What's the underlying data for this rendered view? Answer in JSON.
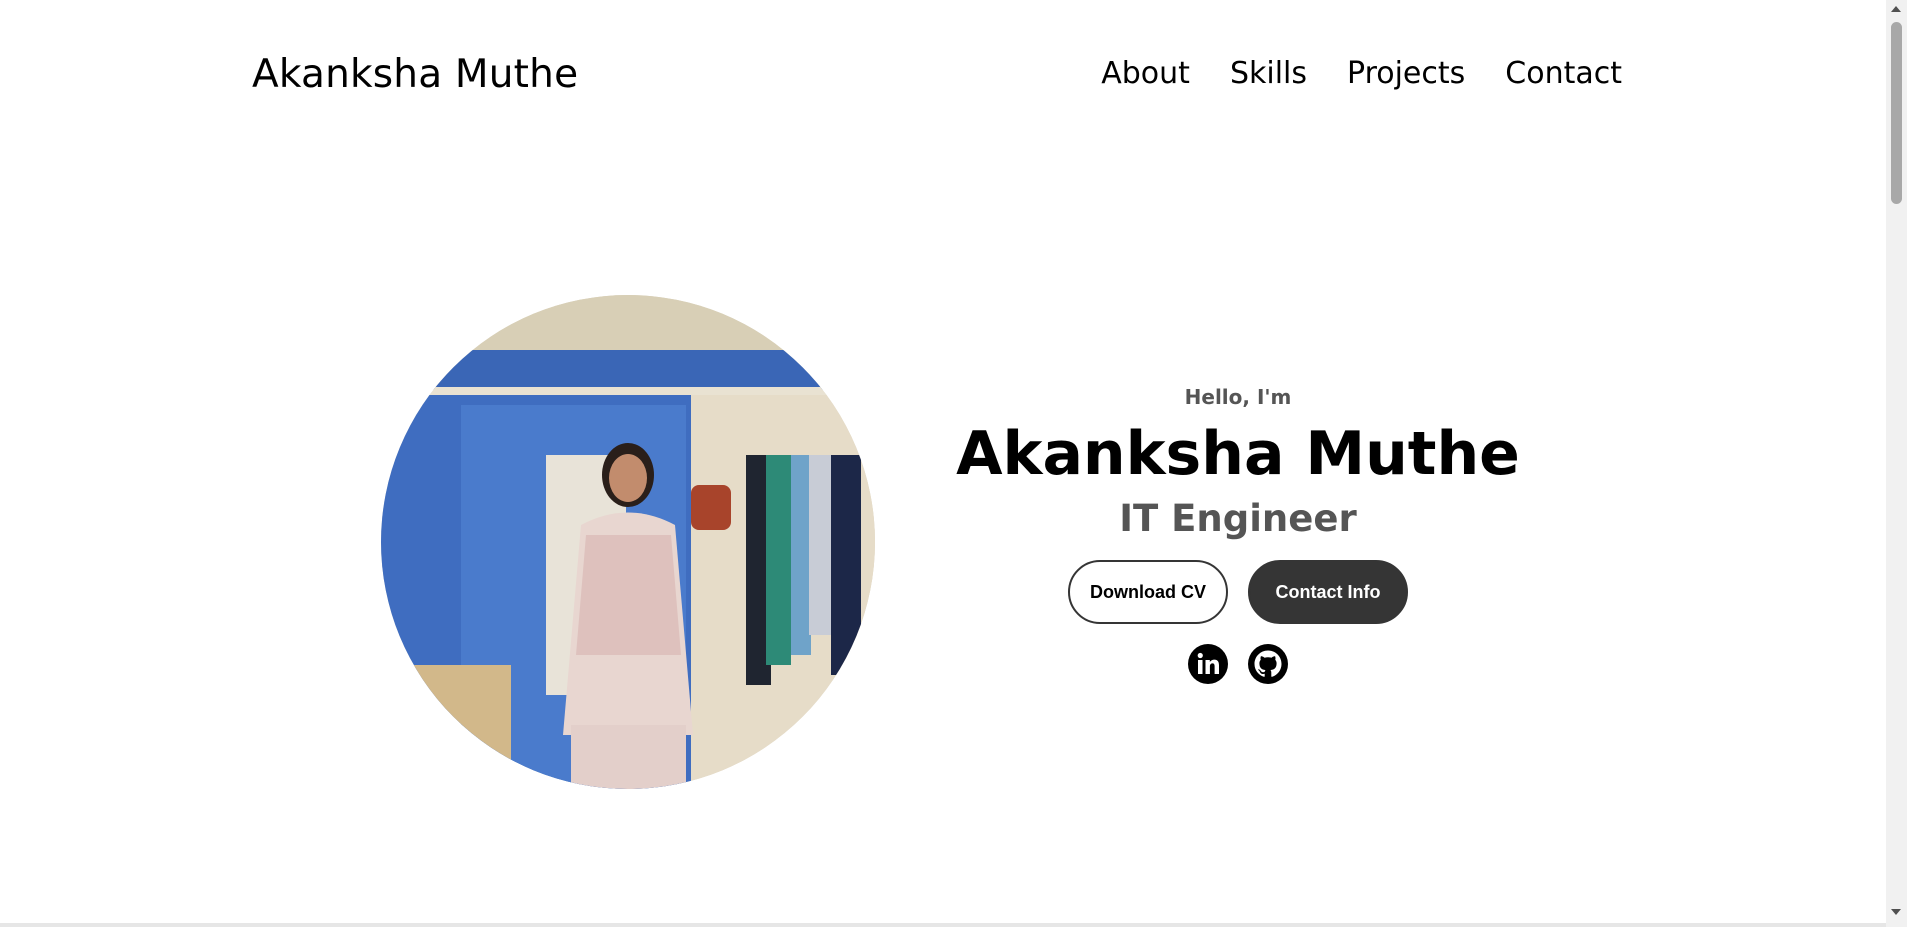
{
  "nav": {
    "logo": "Akanksha Muthe",
    "links": [
      "About",
      "Skills",
      "Projects",
      "Contact"
    ]
  },
  "hero": {
    "greeting": "Hello, I'm",
    "name": "Akanksha Muthe",
    "role": "IT Engineer",
    "buttons": {
      "download_cv": "Download CV",
      "contact_info": "Contact Info"
    },
    "socials": {
      "linkedin": "linkedin-icon",
      "github": "github-icon"
    }
  },
  "colors": {
    "text": "#000000",
    "muted": "#555555",
    "button_dark": "#353535",
    "background": "#ffffff"
  }
}
